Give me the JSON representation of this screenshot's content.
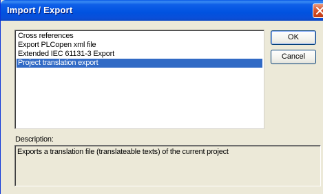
{
  "window": {
    "title": "Import / Export"
  },
  "list": {
    "items": [
      {
        "label": "Cross references",
        "selected": false
      },
      {
        "label": "Export PLCopen xml file",
        "selected": false
      },
      {
        "label": "Extended IEC 61131-3 Export",
        "selected": false
      },
      {
        "label": "Project translation export",
        "selected": true
      }
    ]
  },
  "buttons": {
    "ok_label": "OK",
    "cancel_label": "Cancel"
  },
  "description": {
    "label": "Description:",
    "text": "Exports a translation file (translateable texts) of the current project"
  },
  "colors": {
    "selection": "#316ac5",
    "titlebar": "#0052e0",
    "dialog_bg": "#ece9d8"
  }
}
